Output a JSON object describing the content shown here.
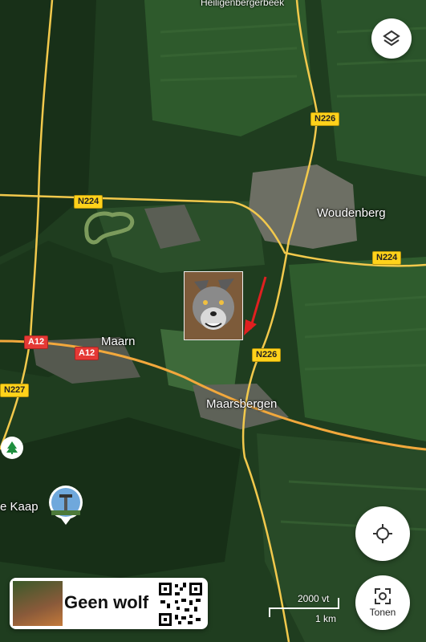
{
  "places": {
    "top": "Heiligenbergerbeek",
    "woudenberg": "Woudenberg",
    "maarn": "Maarn",
    "maarsbergen": "Maarsbergen",
    "kaap": "e Kaap"
  },
  "roads": {
    "n224_west": "N224",
    "n224_east": "N224",
    "n226_north": "N226",
    "n226_south": "N226",
    "a12_west": "A12",
    "a12_mid": "A12",
    "n227": "N227"
  },
  "scale": {
    "imperial": "2000 vt",
    "metric": "1 km"
  },
  "buttons": {
    "layers_icon": "layers-icon",
    "locate_icon": "my-location-icon",
    "lens_icon": "lens-icon",
    "lens_label": "Tonen"
  },
  "overlay": {
    "caption": "Geen wolf"
  },
  "colors": {
    "road": "#f2c94c",
    "highway": "#f2a83c",
    "arrow": "#e02020",
    "map_base": "#1f3d1f"
  }
}
